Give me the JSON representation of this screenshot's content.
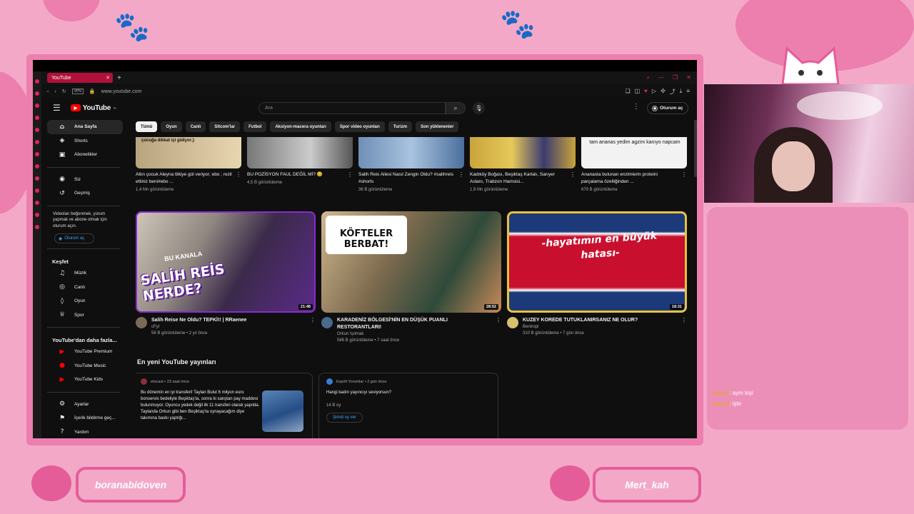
{
  "browser": {
    "tab_title": "YouTube",
    "new_tab": "+",
    "url": "www.youtube.com",
    "vpn": "VPN"
  },
  "youtube": {
    "logo": "YouTube",
    "logo_sup": "TR",
    "search_placeholder": "Ara",
    "signin": "Oturum aç",
    "chips": [
      "Tümü",
      "Oyun",
      "Canlı",
      "Sitcom'lar",
      "Futbol",
      "Aksiyon-macera oyunları",
      "Spor video oyunları",
      "Turizm",
      "Son yüklenenler"
    ],
    "guide": {
      "main": [
        {
          "icon": "home-icon",
          "glyph": "⌂",
          "label": "Ana Sayfa"
        },
        {
          "icon": "shorts-icon",
          "glyph": "◈",
          "label": "Shorts"
        },
        {
          "icon": "subscriptions-icon",
          "glyph": "▣",
          "label": "Abonelikler"
        }
      ],
      "you": [
        {
          "icon": "you-icon",
          "glyph": "◉",
          "label": "Siz"
        },
        {
          "icon": "history-icon",
          "glyph": "↺",
          "label": "Geçmiş"
        }
      ],
      "promo_text": "Videoları beğenmek, yorum yapmak ve abone olmak için oturum açın.",
      "promo_button": "Oturum aç",
      "explore_title": "Keşfet",
      "explore": [
        {
          "icon": "music-icon",
          "glyph": "♫",
          "label": "Müzik"
        },
        {
          "icon": "live-icon",
          "glyph": "◎",
          "label": "Canlı"
        },
        {
          "icon": "gaming-icon",
          "glyph": "◊",
          "label": "Oyun"
        },
        {
          "icon": "sports-icon",
          "glyph": "♕",
          "label": "Spor"
        }
      ],
      "more_title": "YouTube'dan daha fazla...",
      "more": [
        {
          "icon": "youtube-premium-icon",
          "glyph": "▶",
          "label": "YouTube Premium"
        },
        {
          "icon": "youtube-music-icon",
          "glyph": "●",
          "label": "YouTube Music"
        },
        {
          "icon": "youtube-kids-icon",
          "glyph": "▶",
          "label": "YouTube Kids"
        }
      ],
      "footer": [
        {
          "icon": "settings-icon",
          "glyph": "⚙",
          "label": "Ayarlar"
        },
        {
          "icon": "report-icon",
          "glyph": "⚑",
          "label": "İçerik bildirme geç..."
        },
        {
          "icon": "help-icon",
          "glyph": "?",
          "label": "Yardım"
        }
      ]
    },
    "row1": [
      {
        "thumb_text": "çocuğa dikkat içi gidiyor;)",
        "title": "Altın çocuk Aleyna tilkiye gül veriyor; ebo ; rezil ettiniz beni#ebo ...",
        "meta": "1,4 Mn görüntüleme",
        "bg": "linear-gradient(90deg,#b8a47e,#e8d6b0)"
      },
      {
        "thumb_text": "",
        "title": "BU POZİSYON FAUL DEĞİL Mİ? 😊",
        "meta": "4,5 B görüntüleme",
        "bg": "linear-gradient(90deg,#777,#ccc 60%,#555)"
      },
      {
        "thumb_text": "",
        "title": "Salih Reis Ailesi Nasıl Zengin Oldu? #salihreis #shorts",
        "meta": "36 B görüntüleme",
        "bg": "linear-gradient(90deg,#6f8fb6,#a9c3e0 50%,#4b6f9c)"
      },
      {
        "thumb_text": "",
        "title": "Kadıköy Boğası, Beşiktaş Kartalı, Sarıyer Aslanı, Trabzon Hamsisi...",
        "meta": "1,9 Mn görüntüleme",
        "bg": "linear-gradient(90deg,#c9a43b,#e6c85a 40%,#3b3b6f 70%,#c9a43b)"
      },
      {
        "thumb_text": "tam ananas yedim agzim kanıyo napcam",
        "title": "Ananasta bulunan enzimlerin proteini parçalama özelliğinden ...",
        "meta": "679 B görüntüleme",
        "bg": "#f2f2f2"
      }
    ],
    "row2": [
      {
        "thumb_text": "SALİH REİS NERDE?",
        "thumb_small": "BU KANALA",
        "duration": "21:48",
        "title": "Salih Reise Ne Oldu? TEPKİ!! | RRaenee",
        "channel": "cFyt",
        "meta": "56 B görüntüleme • 2 yıl önce"
      },
      {
        "thumb_text": "KÖFTELER BERBAT!",
        "duration": "28:52",
        "title": "KARADENİZ BÖLGESİ'NİN EN DÜŞÜK PUANLI RESTORANTLARI!",
        "channel": "Orkun Işıtmak",
        "meta": "586 B görüntüleme • 7 saat önce"
      },
      {
        "thumb_text": "-hayatımın en büyük hatası-",
        "duration": "18:31",
        "title": "KUZEY KOREDE TUTUKLANIRSANIZ NE OLUR?",
        "channel": "Bentropi",
        "meta": "310 B görüntüleme • 7 gün önce"
      }
    ],
    "posts_title": "En yeni YouTube yayınları",
    "posts": [
      {
        "channel": "etocast • 23 saat önce",
        "body": "Bu dönemin en iyi transferi! Taylan Bulut 6 milyon euro bonservis bedeliyle Beşiktaş'ta, sonra ki satıştan pay maddesi bulunmuyor. Oyuncu yedek değil ilk 11 transferi olarak yapılda. Taylanda Orkun gibi ben Beşiktaş'ta oynayacağım diye takımına baskı yaptığı..."
      },
      {
        "channel": "Esprili Yorumlar • 2 gün önce",
        "body": "Hangi kadın yayıncıyı seviyorsun?",
        "likes": "14 B oy",
        "button": "Şimdi oy ver"
      }
    ]
  },
  "stream": {
    "chat": [
      {
        "user": "velned",
        "text": ": aynı kişi"
      },
      {
        "user": "velned",
        "text": ": işte"
      }
    ],
    "badges": [
      "boranabidoven",
      "Mert_kah"
    ]
  },
  "colors": {
    "overlay_pink": "#f4a8c8",
    "accent_pink": "#e45d99",
    "yt_red": "#ff0000",
    "opera_red": "#b0113a"
  }
}
